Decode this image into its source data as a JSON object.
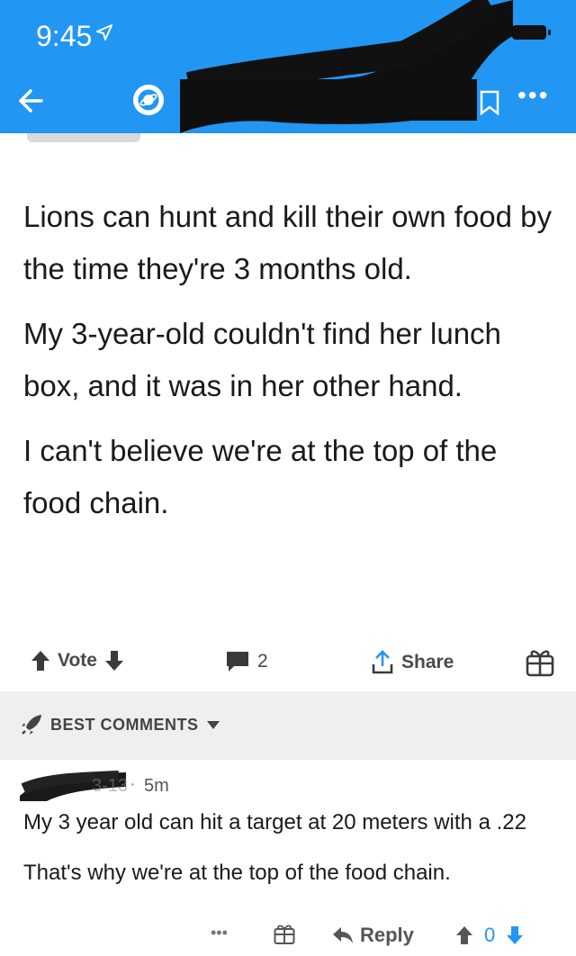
{
  "status_bar": {
    "time": "9:45"
  },
  "post": {
    "paragraphs": [
      "Lions can hunt and kill their own food by the time they're 3 months old.",
      "My 3-year-old couldn't find her lunch box, and it was in her other hand.",
      "I can't believe we're at the top of the food chain."
    ]
  },
  "actions": {
    "vote_label": "Vote",
    "comment_count": "2",
    "share_label": "Share"
  },
  "comments_header": {
    "sort_label": "BEST COMMENTS"
  },
  "comment": {
    "meta_partial": "3-13",
    "age": "5m",
    "paragraphs": [
      "My 3 year old can hit a target at 20 meters with a .22",
      "That's why we're at the top of the food chain."
    ],
    "more_label": "•••",
    "reply_label": "Reply",
    "score": "0"
  },
  "colors": {
    "header": "#2196f3",
    "accent_blue": "#2196f3",
    "text": "#1a1a1b",
    "muted": "#555555"
  }
}
